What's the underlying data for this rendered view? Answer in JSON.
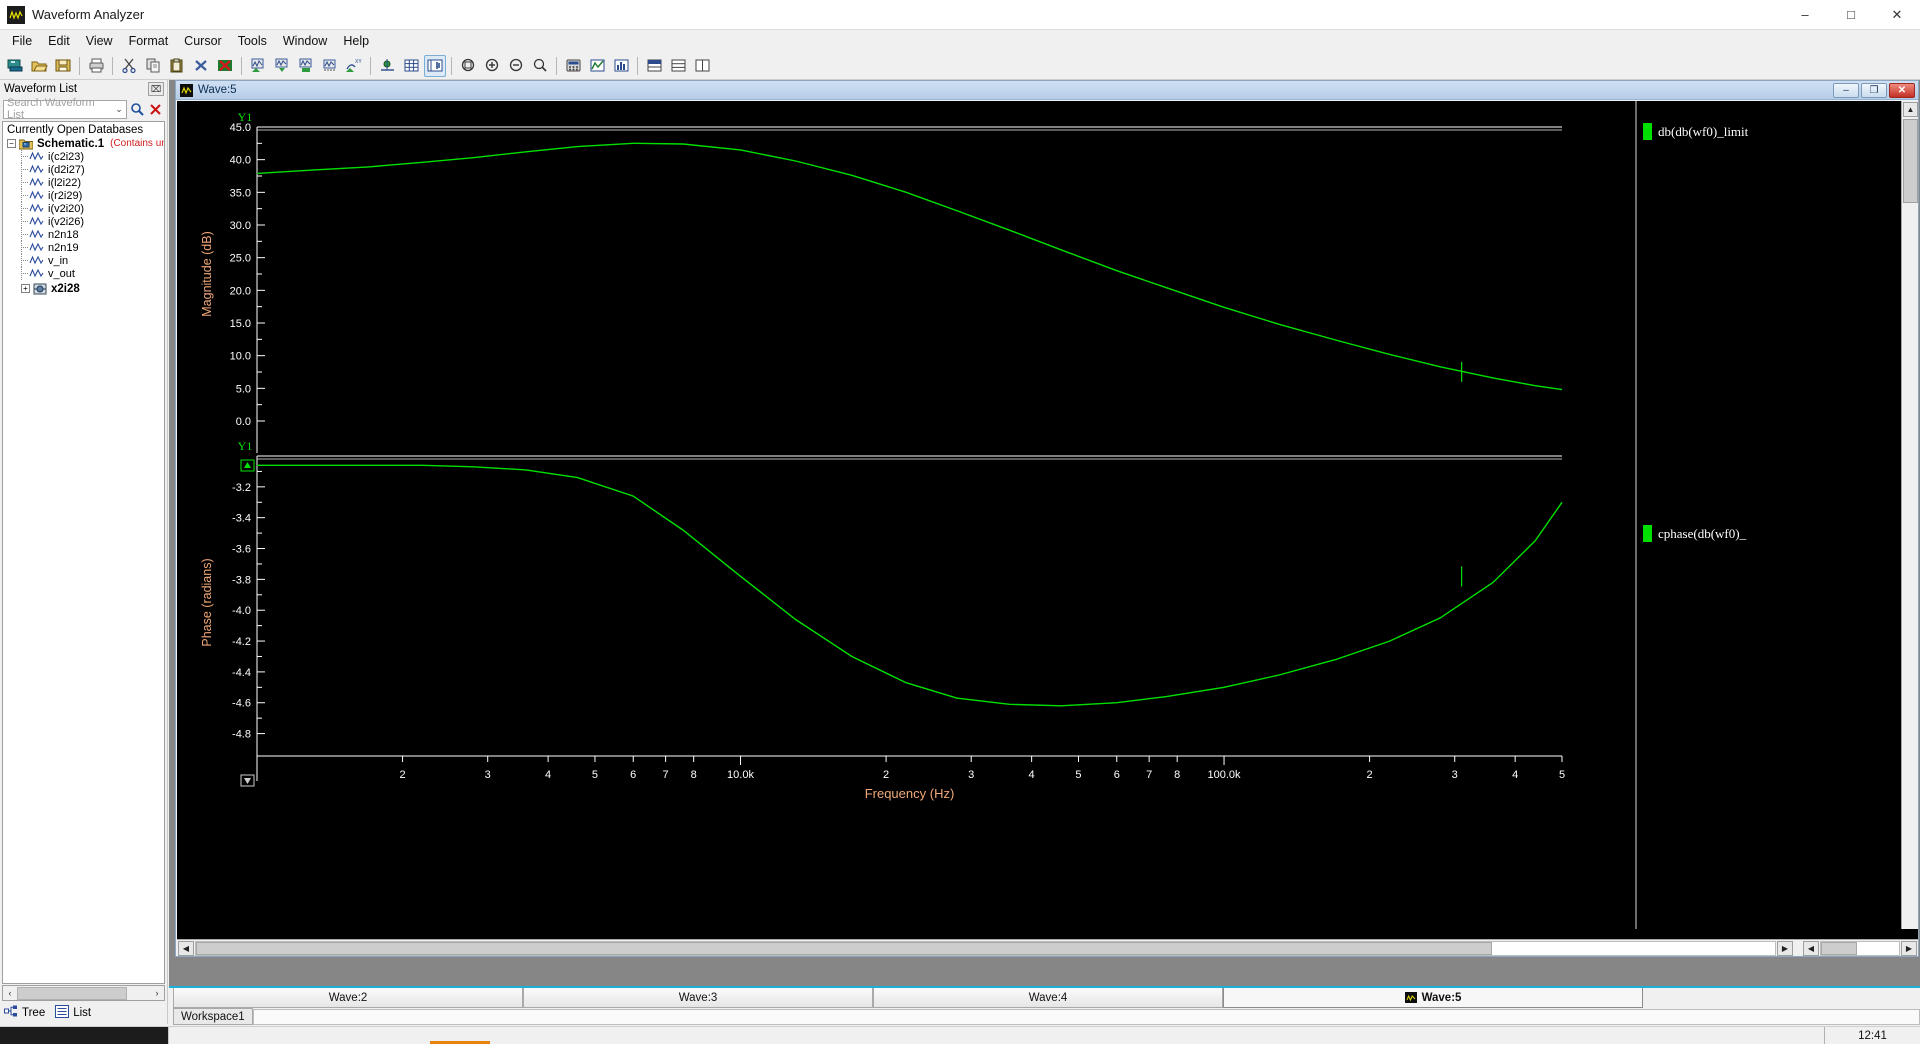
{
  "window": {
    "title": "Waveform Analyzer",
    "app_icon": "waveform-icon",
    "controls": {
      "minimize": "–",
      "maximize": "□",
      "close": "✕"
    }
  },
  "menu": {
    "items": [
      "File",
      "Edit",
      "View",
      "Format",
      "Cursor",
      "Tools",
      "Window",
      "Help"
    ]
  },
  "toolbar": {
    "groups": [
      [
        "new-database-icon",
        "open-folder-icon",
        "save-icon"
      ],
      [
        "print-icon"
      ],
      [
        "cut-icon",
        "copy-icon",
        "paste-icon",
        "delete-icon",
        "delete-all-icon"
      ],
      [
        "add-waveform-icon",
        "insert-waveform-icon",
        "append-waveform-icon",
        "overlay-waveform-icon",
        "xy-plot-icon"
      ],
      [
        "axis-settings-icon",
        "grid-icon",
        "strip-chart-icon"
      ],
      [
        "zoom-fit-icon",
        "zoom-in-icon",
        "zoom-out-icon",
        "zoom-area-icon"
      ],
      [
        "calculator-icon",
        "measure-icon",
        "histogram-icon"
      ],
      [
        "split-horizontal-icon",
        "split-stack-icon",
        "split-vertical-icon"
      ]
    ]
  },
  "waveform_list": {
    "panel_title": "Waveform List",
    "close_glyph": "⌧",
    "search": {
      "placeholder": "Search Waveform List",
      "value": "",
      "dropdown_glyph": "⌄",
      "search_icon": "magnifier-icon",
      "clear_icon": "red-x-icon"
    },
    "tree_root": "Currently Open Databases",
    "database": {
      "name": "Schematic.1",
      "status": "(Contains unsav",
      "expander": "−"
    },
    "signals": [
      "i(c2i23)",
      "i(d2i27)",
      "i(l2i22)",
      "i(r2i29)",
      "i(v2i20)",
      "i(v2i26)",
      "n2n18",
      "n2n19",
      "v_in",
      "v_out"
    ],
    "subcircuit": {
      "name": "x2i28",
      "expander": "+"
    },
    "scroll": {
      "left_arrow": "‹",
      "right_arrow": "›"
    },
    "tabs": [
      {
        "label": "Tree",
        "icon": "tree-view-icon",
        "active": true
      },
      {
        "label": "List",
        "icon": "list-view-icon",
        "active": false
      }
    ]
  },
  "child_window": {
    "title": "Wave:5",
    "icon": "waveform-icon",
    "controls": {
      "minimize": "–",
      "restore": "❐",
      "close": "✕"
    }
  },
  "legend": [
    {
      "label": "db(db(wf0)_limit",
      "color": "#00e000"
    },
    {
      "label": "cphase(db(wf0)_",
      "color": "#00e000"
    }
  ],
  "tabstrip": {
    "tabs": [
      {
        "label": "Wave:2",
        "active": false
      },
      {
        "label": "Wave:3",
        "active": false
      },
      {
        "label": "Wave:4",
        "active": false
      },
      {
        "label": "Wave:5",
        "active": true,
        "icon": "waveform-icon"
      }
    ]
  },
  "workspace": {
    "tab_label": "Workspace1"
  },
  "status": {
    "clock": "12:41"
  },
  "colors": {
    "trace": "#00e000",
    "axis_title": "#f0a878",
    "tick_text": "#ffffff",
    "plot_bg": "#000000",
    "y1_label": "#00e000",
    "db_status_red": "#d21d1d",
    "accent_tab": "#1ab0d8"
  },
  "chart_data": [
    {
      "type": "line",
      "title": "",
      "panel": "magnitude",
      "xlabel": "Frequency (Hz)",
      "ylabel": "Magnitude (dB)",
      "y1_marker": "Y1",
      "xscale": "log",
      "xlim": [
        1000,
        500000
      ],
      "ylim": [
        0,
        45
      ],
      "yticks": [
        45.0,
        40.0,
        35.0,
        30.0,
        25.0,
        20.0,
        15.0,
        10.0,
        5.0,
        0.0
      ],
      "ytick_labels": [
        "45.0",
        "40.0",
        "35.0",
        "30.0",
        "25.0",
        "20.0",
        "15.0",
        "10.0",
        "5.0",
        "0.0"
      ],
      "xtick_labels": [
        "2",
        "3",
        "4",
        "5",
        "6",
        "7",
        "8",
        "10.0k",
        "2",
        "3",
        "4",
        "5",
        "6",
        "7",
        "8",
        "100.0k",
        "2",
        "3",
        "4",
        "5"
      ],
      "xtick_values": [
        2000,
        3000,
        4000,
        5000,
        6000,
        7000,
        8000,
        10000,
        20000,
        30000,
        40000,
        50000,
        60000,
        70000,
        80000,
        100000,
        200000,
        300000,
        400000,
        500000
      ],
      "grid": false,
      "series": [
        {
          "name": "db(db(wf0)_limit",
          "color": "#00e000",
          "x": [
            1000,
            1300,
            1700,
            2200,
            2800,
            3600,
            4600,
            6000,
            7600,
            10000,
            13000,
            17000,
            22000,
            28000,
            36000,
            46000,
            60000,
            76000,
            100000,
            130000,
            170000,
            220000,
            280000,
            360000,
            440000,
            500000
          ],
          "y": [
            37.9,
            38.4,
            38.9,
            39.6,
            40.3,
            41.2,
            42.0,
            42.5,
            42.4,
            41.5,
            39.8,
            37.6,
            35.0,
            32.2,
            29.2,
            26.2,
            23.0,
            20.4,
            17.4,
            14.8,
            12.4,
            10.2,
            8.3,
            6.6,
            5.4,
            4.8
          ]
        }
      ],
      "annotations": [
        {
          "type": "cursor-spike",
          "x": 310000,
          "label": ""
        }
      ]
    },
    {
      "type": "line",
      "title": "",
      "panel": "phase",
      "xlabel": "Frequency (Hz)",
      "ylabel": "Phase (radians)",
      "y1_marker": "Y1",
      "xscale": "log",
      "xlim": [
        1000,
        500000
      ],
      "ylim": [
        -4.9,
        -3.0
      ],
      "yticks": [
        -3.2,
        -3.4,
        -3.6,
        -3.8,
        -4.0,
        -4.2,
        -4.4,
        -4.6,
        -4.8
      ],
      "ytick_labels": [
        "-3.2",
        "-3.4",
        "-3.6",
        "-3.8",
        "-4.0",
        "-4.2",
        "-4.4",
        "-4.6",
        "-4.8"
      ],
      "xtick_labels": [
        "2",
        "3",
        "4",
        "5",
        "6",
        "7",
        "8",
        "10.0k",
        "2",
        "3",
        "4",
        "5",
        "6",
        "7",
        "8",
        "100.0k",
        "2",
        "3",
        "4",
        "5"
      ],
      "xtick_values": [
        2000,
        3000,
        4000,
        5000,
        6000,
        7000,
        8000,
        10000,
        20000,
        30000,
        40000,
        50000,
        60000,
        70000,
        80000,
        100000,
        200000,
        300000,
        400000,
        500000
      ],
      "grid": false,
      "series": [
        {
          "name": "cphase(db(wf0)_",
          "color": "#00e000",
          "x": [
            1000,
            1300,
            1700,
            2200,
            2800,
            3600,
            4600,
            6000,
            7600,
            10000,
            13000,
            17000,
            22000,
            28000,
            36000,
            46000,
            60000,
            76000,
            100000,
            130000,
            170000,
            220000,
            280000,
            360000,
            440000,
            500000
          ],
          "y": [
            -3.06,
            -3.06,
            -3.06,
            -3.06,
            -3.07,
            -3.09,
            -3.14,
            -3.26,
            -3.48,
            -3.78,
            -4.06,
            -4.3,
            -4.47,
            -4.57,
            -4.61,
            -4.62,
            -4.6,
            -4.56,
            -4.5,
            -4.42,
            -4.32,
            -4.2,
            -4.05,
            -3.82,
            -3.55,
            -3.3
          ]
        }
      ],
      "annotations": [
        {
          "type": "cursor-spike",
          "x": 310000,
          "label": ""
        }
      ]
    }
  ]
}
